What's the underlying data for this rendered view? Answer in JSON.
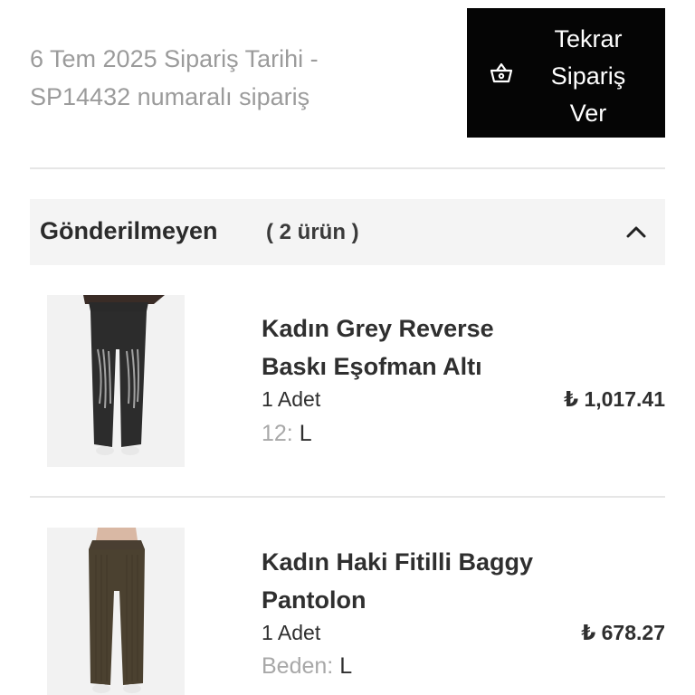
{
  "order": {
    "date_line": "6 Tem 2025 Sipariş Tarihi -",
    "number_line": "SP14432 numaralı sipariş"
  },
  "reorder": {
    "line1": "Tekrar",
    "line2": "Sipariş",
    "line3": "Ver",
    "icon": "basket-icon"
  },
  "group": {
    "title": "Gönderilmeyen",
    "count": "( 2 ürün )",
    "icon": "chevron-up-icon"
  },
  "products": [
    {
      "name_line1": "Kadın Grey Reverse",
      "name_line2": "Baskı Eşofman Altı",
      "quantity": "1 Adet",
      "price": "₺ 1,017.41",
      "size_label": "12:",
      "size_value": "L",
      "image": "black-sweatpants-photo"
    },
    {
      "name_line1": "Kadın Haki Fitilli Baggy",
      "name_line2": "Pantolon",
      "quantity": "1 Adet",
      "price": "₺ 678.27",
      "size_label": "Beden:",
      "size_value": "L",
      "image": "khaki-pants-photo"
    }
  ],
  "colors": {
    "button_bg": "#050505",
    "header_bg": "#f4f4f4",
    "muted_text": "#9b9b9b"
  }
}
